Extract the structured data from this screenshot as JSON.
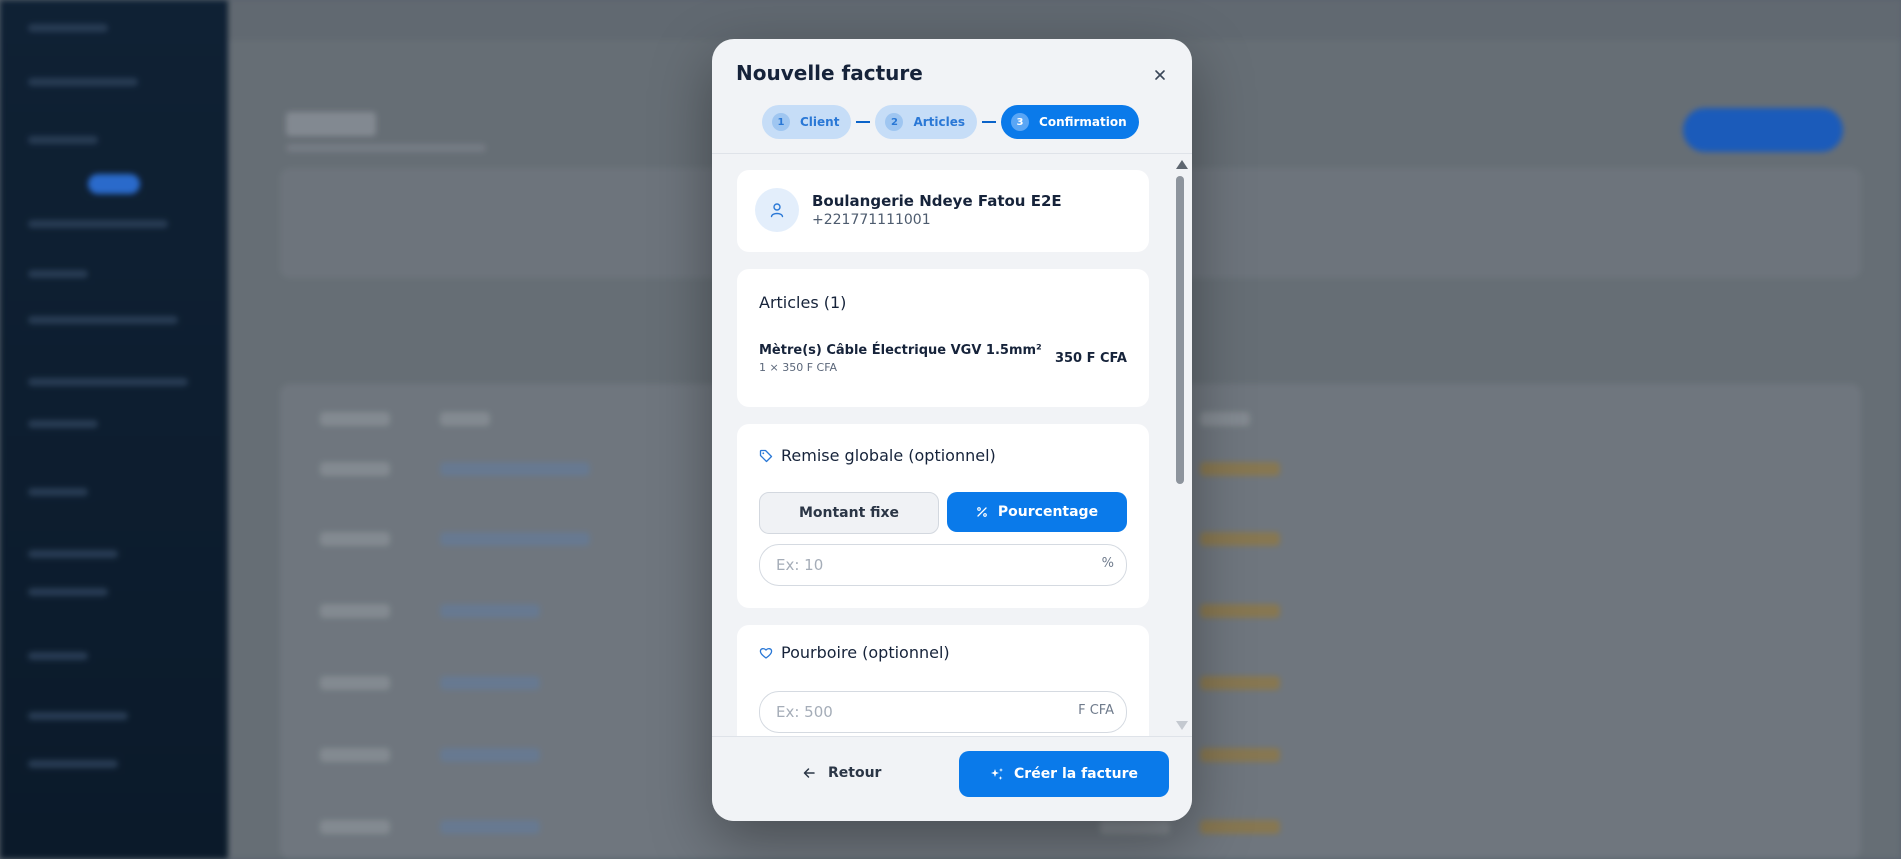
{
  "modal": {
    "title": "Nouvelle facture",
    "steps": [
      {
        "number": "1",
        "label": "Client"
      },
      {
        "number": "2",
        "label": "Articles"
      },
      {
        "number": "3",
        "label": "Confirmation"
      }
    ],
    "active_step": 3
  },
  "client": {
    "name": "Boulangerie Ndeye Fatou E2E",
    "phone": "+221771111001"
  },
  "articles": {
    "title": "Articles (1)",
    "items": [
      {
        "name": "Mètre(s) Câble Électrique VGV 1.5mm²",
        "detail": "1 × 350 F CFA",
        "price": "350 F CFA"
      }
    ]
  },
  "discount": {
    "title": "Remise globale (optionnel)",
    "fixed_label": "Montant fixe",
    "percent_label": "Pourcentage",
    "selected": "percent",
    "placeholder": "Ex: 10",
    "value": "",
    "suffix": "%"
  },
  "tip": {
    "title": "Pourboire (optionnel)",
    "placeholder": "Ex: 500",
    "value": "",
    "suffix": "F CFA"
  },
  "footer": {
    "back_label": "Retour",
    "create_label": "Créer la facture"
  },
  "colors": {
    "primary": "#0a7aea",
    "step_inactive_bg": "#c6ddf7",
    "modal_bg": "#f1f3f6",
    "text_dark": "#16233a"
  },
  "icons": {
    "close": "close-icon",
    "client": "user-icon",
    "discount": "tag-icon",
    "percent": "percent-icon",
    "tip": "heart-icon",
    "back": "arrow-left-icon",
    "create": "sparkles-icon"
  }
}
